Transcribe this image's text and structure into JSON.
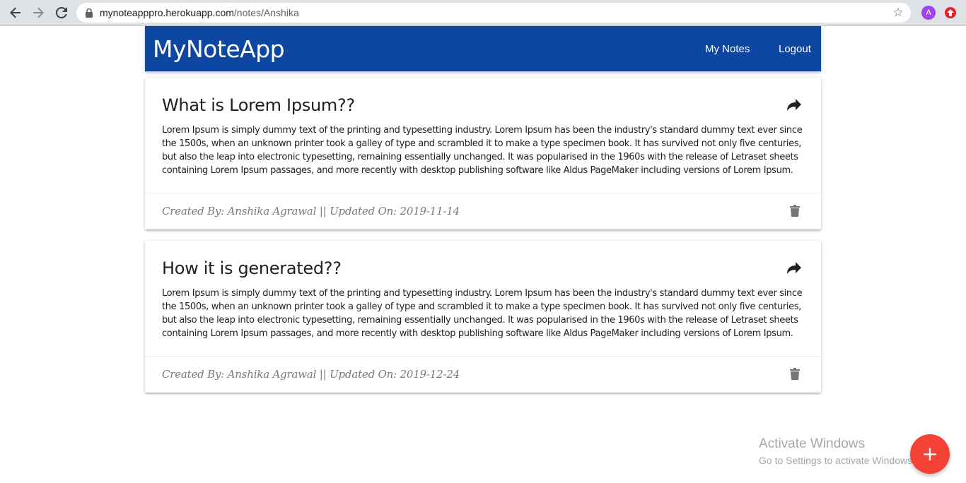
{
  "browser": {
    "url_host": "mynoteapppro.herokuapp.com",
    "url_path": "/notes/Anshika",
    "profile_initial": "A",
    "icons": [
      "back-icon",
      "forward-icon",
      "reload-icon",
      "lock-icon",
      "star-icon",
      "extension-icon"
    ]
  },
  "header": {
    "brand": "MyNoteApp",
    "nav": {
      "my_notes": "My Notes",
      "logout": "Logout"
    },
    "color": "#0d47a1"
  },
  "notes": [
    {
      "title": "What is Lorem Ipsum??",
      "body": "Lorem Ipsum is simply dummy text of the printing and typesetting industry. Lorem Ipsum has been the industry's standard dummy text ever since the 1500s, when an unknown printer took a galley of type and scrambled it to make a type specimen book. It has survived not only five centuries, but also the leap into electronic typesetting, remaining essentially unchanged. It was popularised in the 1960s with the release of Letraset sheets containing Lorem Ipsum passages, and more recently with desktop publishing software like Aldus PageMaker including versions of Lorem Ipsum.",
      "footer": "Created By: Anshika Agrawal || Updated On: 2019-11-14"
    },
    {
      "title": "How it is generated??",
      "body": "Lorem Ipsum is simply dummy text of the printing and typesetting industry. Lorem Ipsum has been the industry's standard dummy text ever since the 1500s, when an unknown printer took a galley of type and scrambled it to make a type specimen book. It has survived not only five centuries, but also the leap into electronic typesetting, remaining essentially unchanged. It was popularised in the 1960s with the release of Letraset sheets containing Lorem Ipsum passages, and more recently with desktop publishing software like Aldus PageMaker including versions of Lorem Ipsum.",
      "footer": "Created By: Anshika Agrawal || Updated On: 2019-12-24"
    }
  ],
  "watermark": {
    "title": "Activate Windows",
    "subtitle": "Go to Settings to activate Windows."
  },
  "fab": {
    "symbol": "+",
    "color": "#f44336"
  }
}
